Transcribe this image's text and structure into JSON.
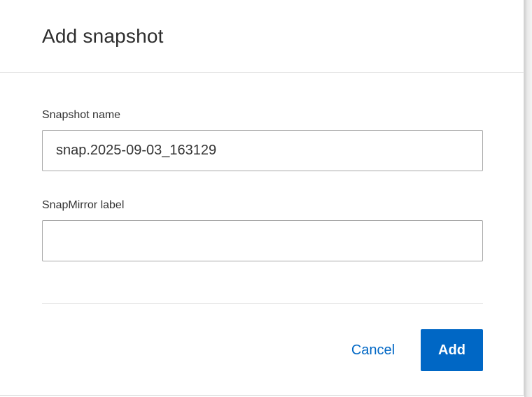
{
  "dialog": {
    "title": "Add snapshot"
  },
  "fields": {
    "snapshot_name": {
      "label": "Snapshot name",
      "value": "snap.2025-09-03_163129"
    },
    "snapmirror_label": {
      "label": "SnapMirror label",
      "value": ""
    }
  },
  "actions": {
    "cancel_label": "Cancel",
    "add_label": "Add"
  },
  "colors": {
    "accent": "#0067c5",
    "title_text": "#2d2d2d",
    "input_border": "#a7a7a7"
  }
}
